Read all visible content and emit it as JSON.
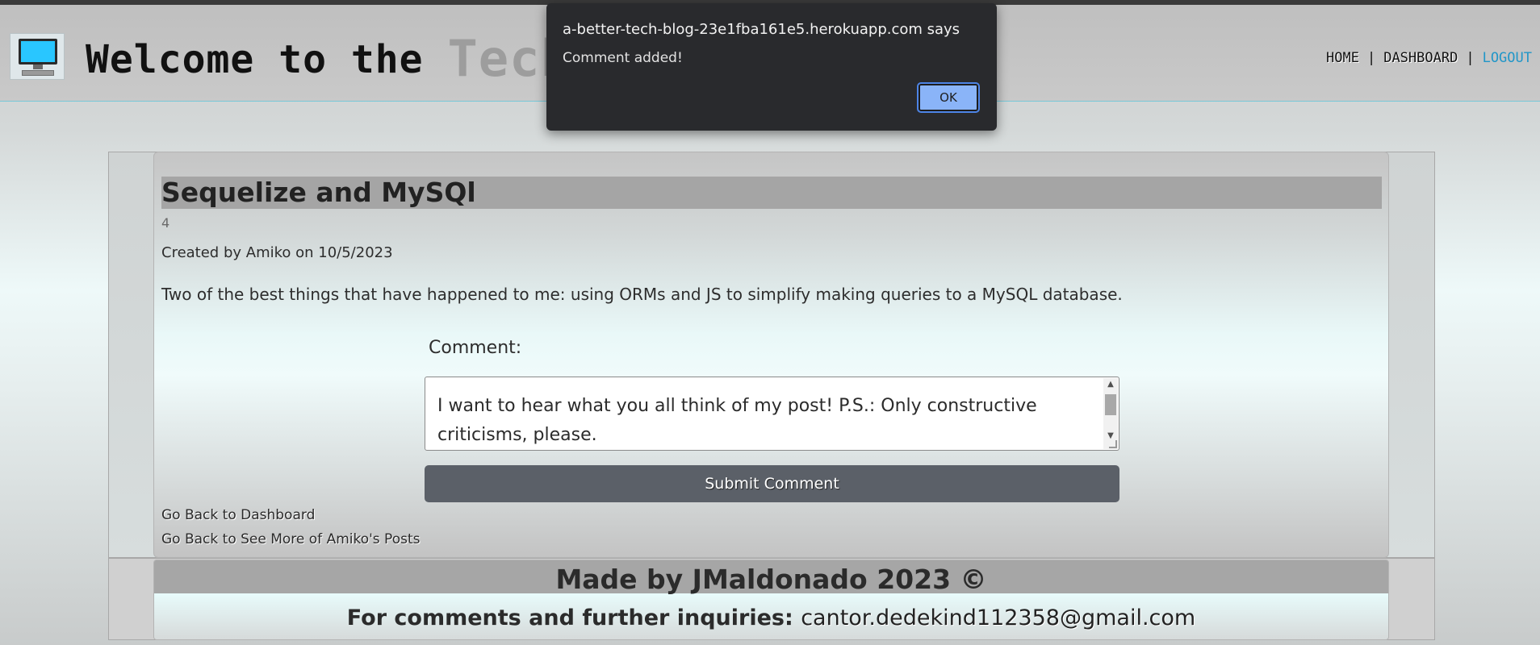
{
  "header": {
    "title_prefix": "Welcome to the ",
    "title_faded": "Tech",
    "nav": {
      "home": "HOME",
      "separator1": "|",
      "dashboard": "DASHBOARD",
      "separator2": "|",
      "logout": "LOGOUT"
    }
  },
  "post": {
    "title": "Sequelize and MySQl",
    "id": "4",
    "meta": "Created by Amiko on 10/5/2023",
    "body": "Two of the best things that have happened to me: using ORMs and JS to simplify making queries to a MySQL database."
  },
  "comment_form": {
    "label": "Comment:",
    "value": "I want to hear what you all think of my post! P.S.: Only constructive criticisms, please.",
    "submit_label": "Submit Comment"
  },
  "links": {
    "back_dashboard": "Go Back to Dashboard",
    "back_posts": "Go Back to See More of Amiko's Posts"
  },
  "footer": {
    "made_by": "Made by JMaldonado 2023 ©",
    "contact_prefix": "For comments and further inquiries: ",
    "email": "cantor.dedekind112358@gmail.com"
  },
  "dialog": {
    "origin": "a-better-tech-blog-23e1fba161e5.herokuapp.com says",
    "message": "Comment added!",
    "ok_label": "OK"
  },
  "icons": {
    "logo": "computer-monitor-icon",
    "scroll_up": "scroll-up-arrow-icon",
    "scroll_down": "scroll-down-arrow-icon"
  },
  "colors": {
    "accent_link": "#2196c8",
    "button": "#5b6068",
    "dialog_bg": "#292a2d",
    "dialog_ok": "#8ab4f8",
    "logo_screen": "#29c6ff"
  }
}
